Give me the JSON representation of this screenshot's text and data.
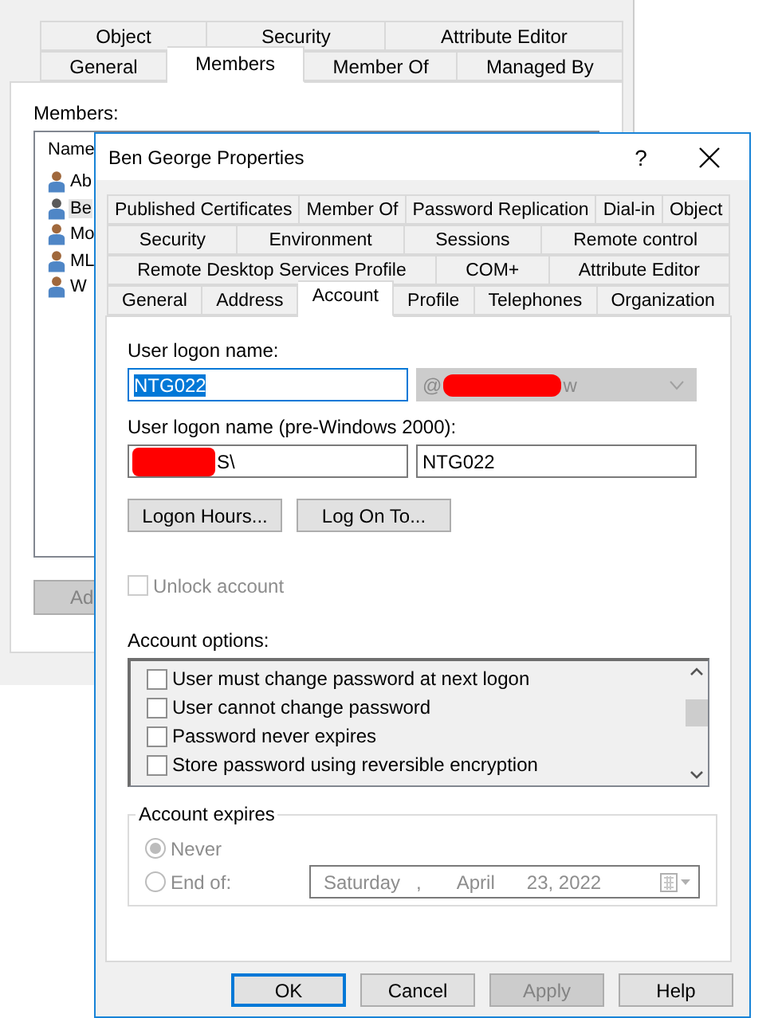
{
  "background_window": {
    "tab_rows": [
      [
        {
          "label": "Object",
          "selected": false
        },
        {
          "label": "Security",
          "selected": false
        },
        {
          "label": "Attribute Editor",
          "selected": false
        }
      ],
      [
        {
          "label": "General",
          "selected": false
        },
        {
          "label": "Members",
          "selected": true
        },
        {
          "label": "Member Of",
          "selected": false
        },
        {
          "label": "Managed By",
          "selected": false
        }
      ]
    ],
    "members_label": "Members:",
    "list_header": "Name",
    "members": [
      {
        "name": "Ab",
        "selected": false
      },
      {
        "name": "Be",
        "selected": true
      },
      {
        "name": "Mo",
        "selected": false
      },
      {
        "name": "ML",
        "selected": false
      },
      {
        "name": "W",
        "selected": false
      }
    ],
    "add_button": {
      "label": "Ad",
      "disabled": true
    }
  },
  "dialog": {
    "title": "Ben George Properties",
    "help_button": "?",
    "tab_rows": [
      [
        {
          "label": "Published Certificates",
          "selected": false
        },
        {
          "label": "Member Of",
          "selected": false
        },
        {
          "label": "Password Replication",
          "selected": false
        },
        {
          "label": "Dial-in",
          "selected": false
        },
        {
          "label": "Object",
          "selected": false
        }
      ],
      [
        {
          "label": "Security",
          "selected": false
        },
        {
          "label": "Environment",
          "selected": false
        },
        {
          "label": "Sessions",
          "selected": false
        },
        {
          "label": "Remote control",
          "selected": false
        }
      ],
      [
        {
          "label": "Remote Desktop Services Profile",
          "selected": false
        },
        {
          "label": "COM+",
          "selected": false
        },
        {
          "label": "Attribute Editor",
          "selected": false
        }
      ],
      [
        {
          "label": "General",
          "selected": false
        },
        {
          "label": "Address",
          "selected": false
        },
        {
          "label": "Account",
          "selected": true
        },
        {
          "label": "Profile",
          "selected": false
        },
        {
          "label": "Telephones",
          "selected": false
        },
        {
          "label": "Organization",
          "selected": false
        }
      ]
    ],
    "user_logon_label": "User logon name:",
    "user_logon": {
      "value": "NTG022",
      "focused": true,
      "text_selected": true
    },
    "domain": {
      "prefix": "@",
      "suffix": "w",
      "disabled": true,
      "redacted": true
    },
    "pre2000_label": "User logon name (pre-Windows 2000):",
    "pre2000_domain": {
      "value": "S\\",
      "redacted": true
    },
    "pre2000_name": {
      "value": "NTG022"
    },
    "buttons": [
      "Logon Hours...",
      "Log On To..."
    ],
    "unlock": {
      "label": "Unlock account",
      "checked": false,
      "disabled": true
    },
    "options_label": "Account options:",
    "options": [
      {
        "label": "User must change password at next logon",
        "checked": false
      },
      {
        "label": "User cannot change password",
        "checked": false
      },
      {
        "label": "Password never expires",
        "checked": false
      },
      {
        "label": "Store password using reversible encryption",
        "checked": false
      }
    ],
    "expires": {
      "title": "Account expires",
      "disabled": true,
      "options": [
        {
          "label": "Never",
          "selected": true
        },
        {
          "label": "End of:",
          "selected": false
        }
      ],
      "date": {
        "weekday": "Saturday",
        "separator": ",",
        "month": "April",
        "day_year": "23, 2022"
      }
    },
    "footer_buttons": [
      {
        "label": "OK",
        "kind": "default",
        "disabled": false
      },
      {
        "label": "Cancel",
        "kind": "normal",
        "disabled": false
      },
      {
        "label": "Apply",
        "kind": "normal",
        "disabled": true
      },
      {
        "label": "Help",
        "kind": "normal",
        "disabled": false
      }
    ]
  }
}
